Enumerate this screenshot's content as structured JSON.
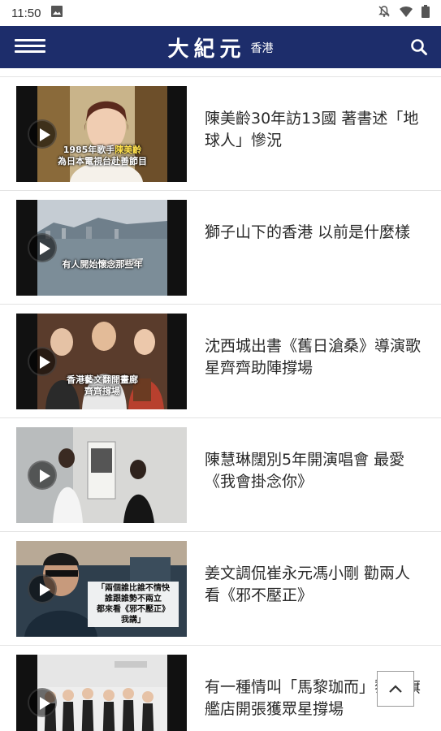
{
  "status_bar": {
    "time": "11:50",
    "icons": [
      "gallery-icon",
      "notifications-off-icon",
      "wifi-icon",
      "battery-icon"
    ]
  },
  "header": {
    "brand": "大紀元",
    "region": "香港",
    "background": "#1d2d6b",
    "menu_icon": "hamburger-menu-icon",
    "search_icon": "search-icon"
  },
  "articles": [
    {
      "title": "陳美齡30年訪13國 著書述「地球人」慘況",
      "caption": "1985年歌手陳美齡\n為日本電視台赴善節目",
      "has_video": true
    },
    {
      "title": "獅子山下的香港 以前是什麼樣",
      "caption": "有人開始懷念那些年",
      "has_video": true
    },
    {
      "title": "沈西城出書《舊日滄桑》導演歌星齊齊助陣撐場",
      "caption": "香港藝文翻開畫廊\n齊齊撐場",
      "has_video": true
    },
    {
      "title": "陳慧琳闊別5年開演唱會 最愛《我會掛念你》",
      "caption": "",
      "has_video": true
    },
    {
      "title": "姜文調侃崔永元馮小剛 勸兩人看《邪不壓正》",
      "caption": "「兩個誰比誰不情快\n誰跟誰勢不兩立\n都來看《邪不壓正》\n我講」",
      "has_video": true
    },
    {
      "title": "有一種情叫「馬黎珈而」黎姿旗艦店開張獲眾星撐場",
      "caption": "",
      "has_video": true
    }
  ],
  "scroll_top": {
    "icon": "chevron-up-icon"
  }
}
